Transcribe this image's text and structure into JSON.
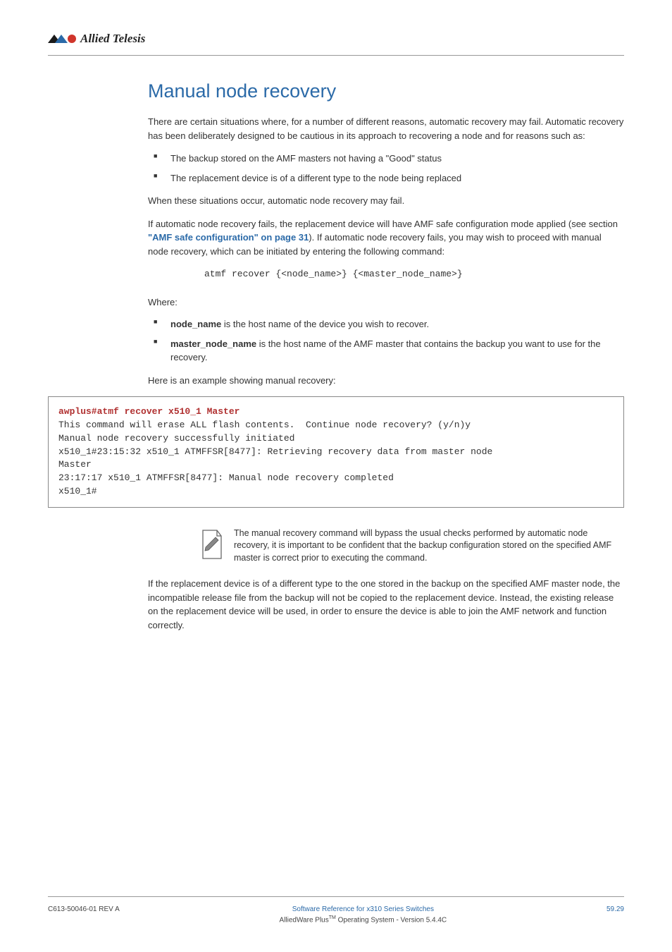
{
  "brand_name": "Allied Telesis",
  "section": {
    "title": "Manual node recovery",
    "intro": "There are certain situations where, for a number of different reasons, automatic recovery may fail. Automatic recovery has been deliberately designed to be cautious in its approach to recovering a node and for reasons such as:",
    "reasons": [
      "The backup stored on the AMF masters not having a \"Good\" status",
      "The replacement device is of a different type to the node being replaced"
    ],
    "fail_line": "When these situations occur, automatic node recovery may fail.",
    "safe_config_pre": "If automatic node recovery fails, the replacement device will have AMF safe configuration mode applied (see section ",
    "safe_config_link": "\"AMF safe configuration\" on page 31",
    "safe_config_post": "). If automatic node recovery fails, you may wish to proceed with manual node recovery, which can be initiated by entering the following command:",
    "cmd_syntax": "atmf recover {<node_name>} {<master_node_name>}",
    "where_label": "Where:",
    "where_items": [
      {
        "term": "node_name",
        "desc": " is the host name of the device you wish to recover."
      },
      {
        "term": "master_node_name",
        "desc": " is the host name of the AMF master that contains the backup you want to use for the recovery."
      }
    ],
    "example_intro": "Here is an example showing manual recovery:",
    "example_cmd": "awplus#atmf recover x510_1 Master",
    "example_output": "This command will erase ALL flash contents.  Continue node recovery? (y/n)y\nManual node recovery successfully initiated\nx510_1#23:15:32 x510_1 ATMFFSR[8477]: Retrieving recovery data from master node\nMaster\n23:17:17 x510_1 ATMFFSR[8477]: Manual node recovery completed\nx510_1#",
    "note_text": "The manual recovery command will bypass the usual checks performed by automatic node recovery, it is important to be confident that the backup configuration stored on the specified AMF master is correct prior to executing the command.",
    "closing": "If the replacement device is of a different type to the one stored in the backup on the specified AMF master node, the incompatible release file from the backup will not be copied to the replacement device. Instead, the existing release on the replacement device will be used, in order to ensure the device is able to join the AMF network and function correctly."
  },
  "footer": {
    "left": "C613-50046-01 REV A",
    "center_line1": "Software Reference for x310 Series Switches",
    "center_line2_pre": "AlliedWare Plus",
    "center_line2_post": " Operating System - Version 5.4.4C",
    "right": "59.29"
  }
}
